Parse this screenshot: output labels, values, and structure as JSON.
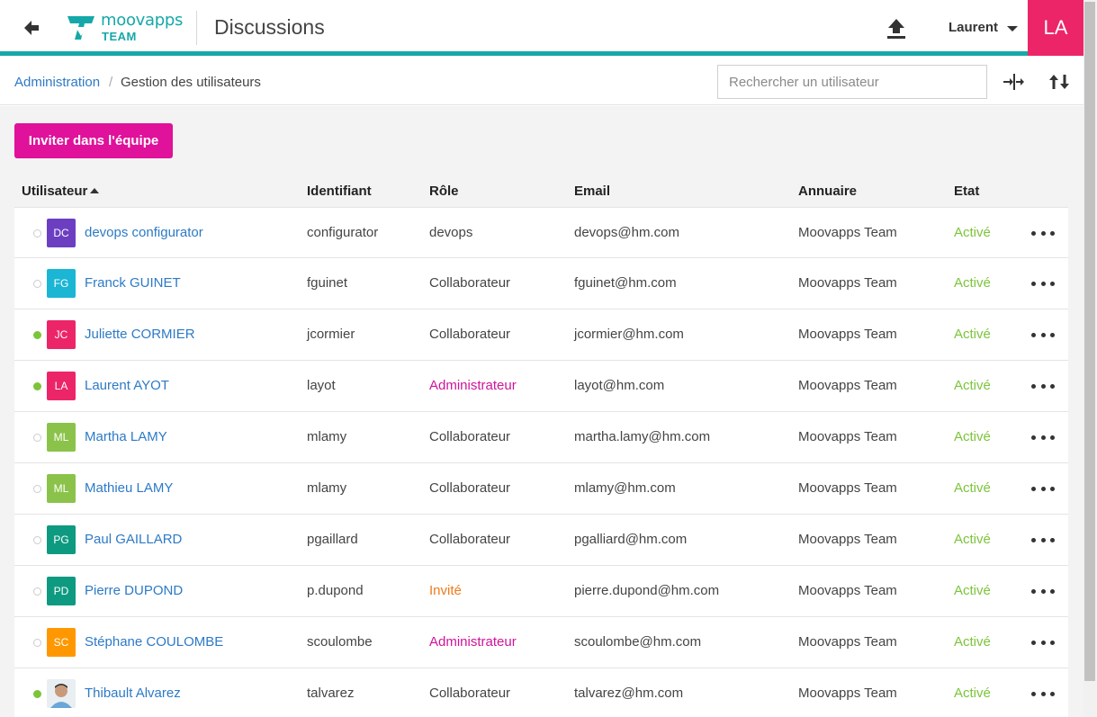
{
  "header": {
    "logo_text": "moovapps",
    "logo_team": "TEAM",
    "title": "Discussions",
    "user_name": "Laurent",
    "avatar_initials": "LA",
    "accent_color": "#16a8a8",
    "avatar_color": "#ec2569"
  },
  "breadcrumb": {
    "parent": "Administration",
    "separator": "/",
    "current": "Gestion des utilisateurs"
  },
  "search": {
    "placeholder": "Rechercher un utilisateur",
    "value": ""
  },
  "toolbar_icons": [
    "collapse-columns-icon",
    "sort-icon"
  ],
  "invite_button": "Inviter dans l'équipe",
  "table": {
    "columns": [
      "Utilisateur",
      "Identifiant",
      "Rôle",
      "Email",
      "Annuaire",
      "Etat"
    ],
    "sorted_column": "Utilisateur",
    "sort_direction": "asc",
    "rows": [
      {
        "initials": "DC",
        "avatar_color": "#6c3fc2",
        "online": false,
        "name": "devops configurator",
        "identifiant": "configurator",
        "role": "devops",
        "role_color": "#444444",
        "email": "devops@hm.com",
        "annuaire": "Moovapps Team",
        "etat": "Activé"
      },
      {
        "initials": "FG",
        "avatar_color": "#1ab6d4",
        "online": false,
        "name": "Franck GUINET",
        "identifiant": "fguinet",
        "role": "Collaborateur",
        "role_color": "#444444",
        "email": "fguinet@hm.com",
        "annuaire": "Moovapps Team",
        "etat": "Activé"
      },
      {
        "initials": "JC",
        "avatar_color": "#ec2569",
        "online": true,
        "name": "Juliette CORMIER",
        "identifiant": "jcormier",
        "role": "Collaborateur",
        "role_color": "#444444",
        "email": "jcormier@hm.com",
        "annuaire": "Moovapps Team",
        "etat": "Activé"
      },
      {
        "initials": "LA",
        "avatar_color": "#ec2569",
        "online": true,
        "name": "Laurent AYOT",
        "identifiant": "layot",
        "role": "Administrateur",
        "role_color": "#d0139a",
        "email": "layot@hm.com",
        "annuaire": "Moovapps Team",
        "etat": "Activé"
      },
      {
        "initials": "ML",
        "avatar_color": "#8bc34a",
        "online": false,
        "name": "Martha LAMY",
        "identifiant": "mlamy",
        "role": "Collaborateur",
        "role_color": "#444444",
        "email": "martha.lamy@hm.com",
        "annuaire": "Moovapps Team",
        "etat": "Activé"
      },
      {
        "initials": "ML",
        "avatar_color": "#8bc34a",
        "online": false,
        "name": "Mathieu LAMY",
        "identifiant": "mlamy",
        "role": "Collaborateur",
        "role_color": "#444444",
        "email": "mlamy@hm.com",
        "annuaire": "Moovapps Team",
        "etat": "Activé"
      },
      {
        "initials": "PG",
        "avatar_color": "#0e9a80",
        "online": false,
        "name": "Paul GAILLARD",
        "identifiant": "pgaillard",
        "role": "Collaborateur",
        "role_color": "#444444",
        "email": "pgalliard@hm.com",
        "annuaire": "Moovapps Team",
        "etat": "Activé"
      },
      {
        "initials": "PD",
        "avatar_color": "#0e9a80",
        "online": false,
        "name": "Pierre DUPOND",
        "identifiant": "p.dupond",
        "role": "Invité",
        "role_color": "#f07a1a",
        "email": "pierre.dupond@hm.com",
        "annuaire": "Moovapps Team",
        "etat": "Activé"
      },
      {
        "initials": "SC",
        "avatar_color": "#ff9800",
        "online": false,
        "name": "Stéphane COULOMBE",
        "identifiant": "scoulombe",
        "role": "Administrateur",
        "role_color": "#d0139a",
        "email": "scoulombe@hm.com",
        "annuaire": "Moovapps Team",
        "etat": "Activé"
      },
      {
        "initials": "",
        "avatar_color": "#ffffff",
        "photo": true,
        "online": true,
        "name": "Thibault Alvarez",
        "identifiant": "talvarez",
        "role": "Collaborateur",
        "role_color": "#444444",
        "email": "talvarez@hm.com",
        "annuaire": "Moovapps Team",
        "etat": "Activé"
      }
    ]
  },
  "colors": {
    "active_state": "#7cc43a",
    "link": "#2d7ac6",
    "invite_button": "#e0119a"
  }
}
